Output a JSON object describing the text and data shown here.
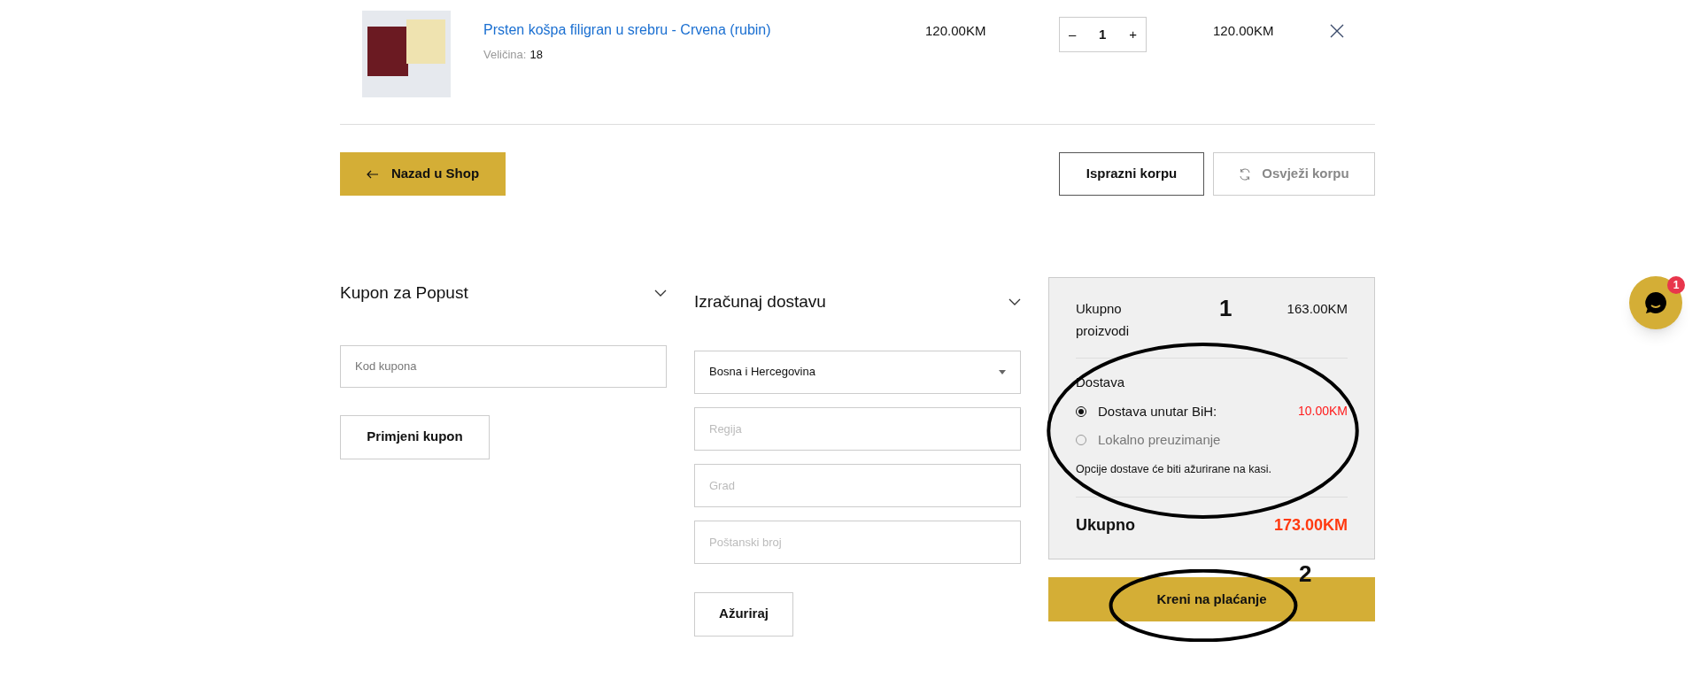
{
  "cart_item": {
    "name": "Prsten košpa filigran u srebru - Crvena (rubin)",
    "size_label": "Veličina:",
    "size_value": "18",
    "price": "120.00KM",
    "decrement": "–",
    "quantity": "1",
    "increment": "+",
    "subtotal": "120.00KM"
  },
  "actions": {
    "back": "Nazad u Shop",
    "empty": "Isprazni korpu",
    "refresh": {
      "label": "Osvježi korpu",
      "disabled": true
    }
  },
  "coupon": {
    "title": "Kupon za Popust",
    "placeholder": "Kod kupona",
    "button": "Primjeni kupon"
  },
  "shipping_calculator": {
    "title": "Izračunaj dostavu",
    "country": "Bosna i Hercegovina",
    "fields": [
      {
        "placeholder": "Regija"
      },
      {
        "placeholder": "Grad"
      },
      {
        "placeholder": "Poštanski broj"
      }
    ],
    "button": "Ažuriraj"
  },
  "totals": {
    "subtotal_label": "Ukupno proizvodi",
    "subtotal": "163.00KM",
    "shipping_label": "Dostava",
    "shipping_options": [
      {
        "label": "Dostava unutar BiH:",
        "price": "10.00KM",
        "selected": true
      },
      {
        "label": "Lokalno preuzimanje",
        "selected": false
      }
    ],
    "note": "Opcije dostave će biti ažurirane na kasi.",
    "total_label": "Ukupno",
    "total": "173.00KM"
  },
  "checkout_button": "Kreni na plaćanje",
  "annotations": [
    {
      "number": "1"
    },
    {
      "number": "2"
    }
  ],
  "chat": {
    "badge": "1"
  }
}
